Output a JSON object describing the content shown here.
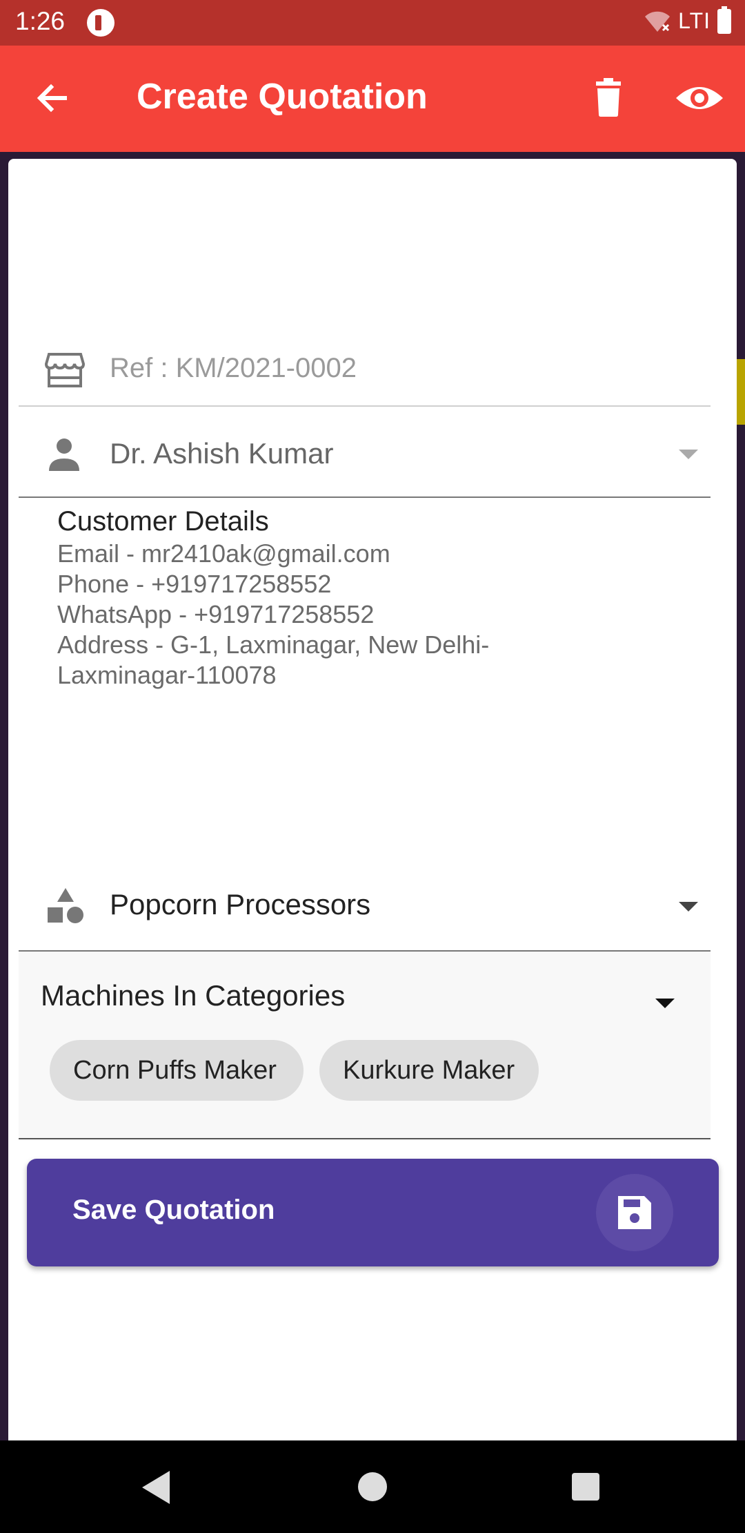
{
  "status_bar": {
    "time": "1:26",
    "network": "LTI"
  },
  "app_bar": {
    "title": "Create Quotation"
  },
  "form": {
    "reference": "Ref : KM/2021-0002",
    "customer": "Dr. Ashish Kumar",
    "customer_details": {
      "heading": "Customer Details",
      "email": "Email - mr2410ak@gmail.com",
      "phone": "Phone - +919717258552",
      "whatsapp": "WhatsApp - +919717258552",
      "address_line1": "Address - G-1, Laxminagar, New Delhi-",
      "address_line2": "Laxminagar-110078"
    },
    "category": "Popcorn Processors",
    "machines": {
      "label": "Machines In Categories",
      "chips": [
        "Corn Puffs Maker",
        "Kurkure Maker"
      ]
    }
  },
  "actions": {
    "save_label": "Save Quotation"
  },
  "colors": {
    "status_bar": "#b5312b",
    "app_bar": "#f4433a",
    "save_button": "#4f3d9d"
  },
  "icons": [
    "back-arrow-icon",
    "delete-icon",
    "eye-icon",
    "store-icon",
    "person-icon",
    "shapes-icon",
    "save-icon"
  ]
}
